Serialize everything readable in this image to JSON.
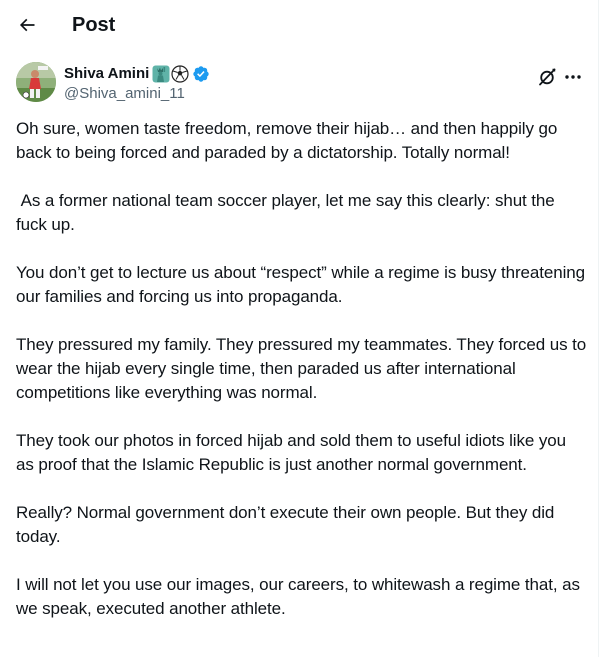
{
  "header": {
    "title": "Post",
    "back_icon": "arrow-left-icon"
  },
  "author": {
    "display_name": "Shiva Amini",
    "name_emojis": [
      "statue-of-liberty-emoji",
      "soccer-ball-emoji"
    ],
    "verified_badge": "blue-check-icon",
    "handle": "@Shiva_amini_11",
    "avatar": "avatar-photo"
  },
  "actions": {
    "grok_icon": "grok-icon",
    "more_icon": "more-options-icon"
  },
  "tweet": {
    "paragraphs": [
      "Oh sure, women taste freedom, remove their hijab… and then happily go back to being forced and paraded by a dictatorship. Totally normal!",
      " As a former national team soccer player, let me say this clearly: shut the fuck up.",
      "You don’t get to lecture us about “respect” while a regime is busy threatening our families and forcing us into propaganda.",
      "They pressured my family. They pressured my teammates. They forced us to wear the hijab every single time, then paraded us after international competitions like everything was normal.",
      "They took our photos in forced hijab and sold them to useful idiots like you as proof that the Islamic Republic is just another normal government.",
      "Really? Normal government don’t execute their own people. But they did today.",
      "I will not let you use our images, our careers, to whitewash a regime that, as we speak, executed another athlete."
    ]
  },
  "colors": {
    "text": "#0f1419",
    "secondary_text": "#536471",
    "verified_blue": "#1d9bf0",
    "background": "#ffffff"
  }
}
